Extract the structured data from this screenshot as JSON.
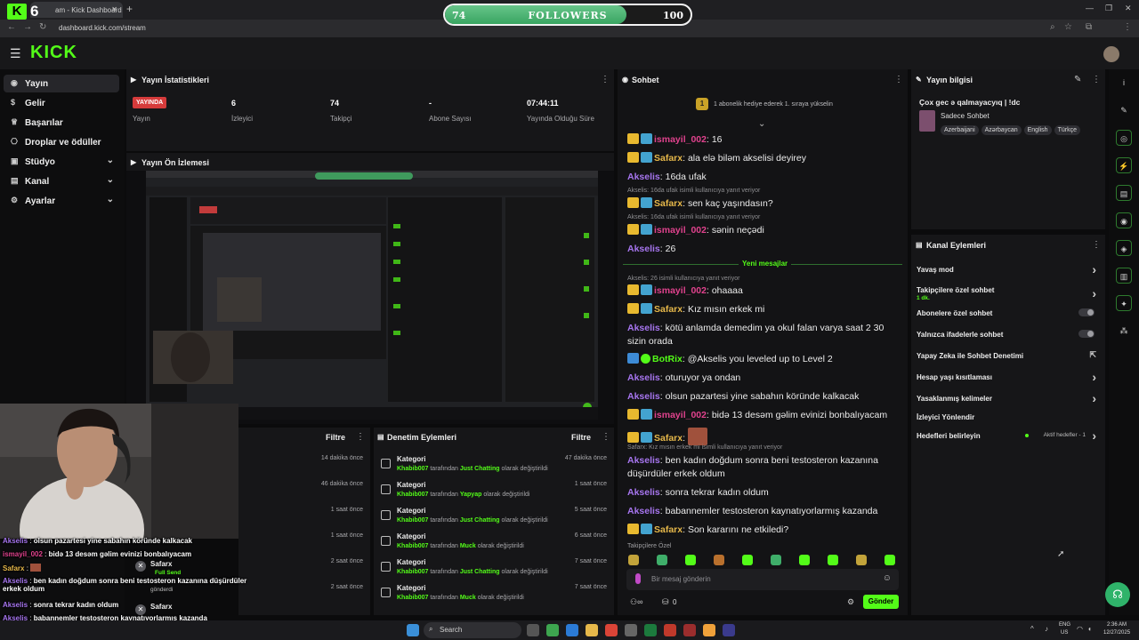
{
  "browser": {
    "tab_title": "am - Kick Dashboard",
    "url": "dashboard.kick.com/stream"
  },
  "overlay": {
    "kick_count": "6",
    "goal": {
      "current": "74",
      "label": "FOLLOWERS",
      "max": "100",
      "progress": 0.74
    }
  },
  "app": {
    "logo": "KICK"
  },
  "sidebar": {
    "items": [
      {
        "label": "Yayın",
        "icon": "broadcast-icon",
        "active": true
      },
      {
        "label": "Gelir",
        "icon": "dollar-icon"
      },
      {
        "label": "Başarılar",
        "icon": "trophy-icon"
      },
      {
        "label": "Droplar ve ödüller",
        "icon": "gift-icon"
      },
      {
        "label": "Stüdyo",
        "icon": "studio-icon",
        "chevron": true
      },
      {
        "label": "Kanal",
        "icon": "channel-icon",
        "chevron": true
      },
      {
        "label": "Ayarlar",
        "icon": "gear-icon",
        "chevron": true
      }
    ]
  },
  "stats": {
    "title": "Yayın İstatistikleri",
    "live_badge": "YAYINDA",
    "items": [
      {
        "value": "",
        "label": "Yayın"
      },
      {
        "value": "6",
        "label": "İzleyici"
      },
      {
        "value": "74",
        "label": "Takipçi"
      },
      {
        "value": "-",
        "label": "Abone Sayısı"
      },
      {
        "value": "07:44:11",
        "label": "Yayında Olduğu Süre"
      }
    ]
  },
  "preview": {
    "title": "Yayın Ön İzlemesi"
  },
  "chat": {
    "title": "Sohbet",
    "pinned": "1 abonelik hediye ederek 1. sıraya yükselin",
    "new_messages": "Yeni mesajlar",
    "input_placeholder": "Bir mesaj gönderin",
    "send_label": "Gönder",
    "followers_only": "Takipçilere Özel",
    "counter": "0",
    "colors": {
      "ismayil": "#e0428d",
      "safarx": "#e6b84a",
      "akselis": "#a675ee",
      "botrix": "#53fc18"
    },
    "messages": [
      {
        "user": "ismayil_002",
        "color": "#e0428d",
        "badges": [
          "crown",
          "sub"
        ],
        "text": "16"
      },
      {
        "user": "Safarx",
        "color": "#e6b84a",
        "badges": [
          "crown",
          "sub"
        ],
        "text": "ala elə biləm akselisi deyirey"
      },
      {
        "user": "Akselis",
        "color": "#a675ee",
        "badges": [],
        "text": "16da ufak"
      },
      {
        "reply": "Akselis: 16da ufak isimli kullanıcıya yanıt veriyor",
        "user": "Safarx",
        "color": "#e6b84a",
        "badges": [
          "crown",
          "sub"
        ],
        "text": "sen kaç yaşındasın?"
      },
      {
        "reply": "Akselis: 16da ufak isimli kullanıcıya yanıt veriyor",
        "user": "ismayil_002",
        "color": "#e0428d",
        "badges": [
          "crown",
          "sub"
        ],
        "text": "sənin neçədi"
      },
      {
        "user": "Akselis",
        "color": "#a675ee",
        "badges": [],
        "text": "26"
      },
      {
        "reply": "Akselis: 26 isimli kullanıcıya yanıt veriyor",
        "user": "ismayil_002",
        "color": "#e0428d",
        "badges": [
          "crown",
          "sub"
        ],
        "text": "ohaaaa"
      },
      {
        "user": "Safarx",
        "color": "#e6b84a",
        "badges": [
          "crown",
          "sub"
        ],
        "text": "Kız mısın erkek mi"
      },
      {
        "user": "Akselis",
        "color": "#a675ee",
        "badges": [],
        "text": "kötü anlamda demedim ya okul falan varya saat 2 30 sizin orada"
      },
      {
        "user": "BotRix",
        "color": "#53fc18",
        "badges": [
          "bot",
          "verif"
        ],
        "text": "@Akselis you leveled up to Level 2"
      },
      {
        "user": "Akselis",
        "color": "#a675ee",
        "badges": [],
        "text": "oturuyor ya ondan"
      },
      {
        "user": "Akselis",
        "color": "#a675ee",
        "badges": [],
        "text": "olsun pazartesi yine sabahın köründe kalkacak"
      },
      {
        "user": "ismayil_002",
        "color": "#e0428d",
        "badges": [
          "crown",
          "sub"
        ],
        "text": "bidə 13 desəm gəlim evinizi bonbalıyacam"
      },
      {
        "user": "Safarx",
        "color": "#e6b84a",
        "badges": [
          "crown",
          "sub"
        ],
        "text": ""
      },
      {
        "reply": "Safarx: Kız mısın erkek mi isimli kullanıcıya yanıt veriyor",
        "user": "Akselis",
        "color": "#a675ee",
        "badges": [],
        "text": "ben kadın doğdum sonra beni testosteron kazanına düşürdüler erkek oldum"
      },
      {
        "user": "Akselis",
        "color": "#a675ee",
        "badges": [],
        "text": "sonra tekrar kadın oldum"
      },
      {
        "user": "Akselis",
        "color": "#a675ee",
        "badges": [],
        "text": "babannemler testosteron kaynatıyorlarmış kazanda"
      },
      {
        "user": "Safarx",
        "color": "#e6b84a",
        "badges": [
          "crown",
          "sub"
        ],
        "text": "Son kararını ne etkiledi?"
      }
    ]
  },
  "info": {
    "title": "Yayın bilgisi",
    "stream_title": "Çox gec ə qalmayacyıq | !dc",
    "category": "Sadece Sohbet",
    "tags": [
      "Azerbaijani",
      "Azərbaycan",
      "English",
      "Türkçe"
    ]
  },
  "actions": {
    "title": "Kanal Eylemleri",
    "rows": [
      {
        "label": "Yavaş mod",
        "kind": "chevron"
      },
      {
        "label": "Takipçilere özel sohbet",
        "sub": "1 dk.",
        "kind": "chevron"
      },
      {
        "label": "Abonelere özel sohbet",
        "kind": "toggle"
      },
      {
        "label": "Yalnızca ifadelerle sohbet",
        "kind": "toggle"
      },
      {
        "label": "Yapay Zeka ile Sohbet Denetimi",
        "kind": "external"
      },
      {
        "label": "Hesap yaşı kısıtlaması",
        "kind": "chevron"
      },
      {
        "label": "Yasaklanmış kelimeler",
        "kind": "chevron"
      },
      {
        "label": "İzleyici Yönlendir",
        "kind": "none"
      },
      {
        "label": "Hedefleri belirleyin",
        "kind": "chevron",
        "status": "Aktif hedefler - 1"
      }
    ]
  },
  "activity": {
    "filter": "Filtre",
    "times": [
      "14 dakika önce",
      "46 dakika önce",
      "1 saat önce",
      "1 saat önce",
      "2 saat önce",
      "2 saat önce"
    ],
    "overlay_names": [
      "Safarx",
      "Safarx"
    ],
    "overlay_notes": [
      "Full Send",
      "gönderdi"
    ]
  },
  "modlog": {
    "title": "Denetim Eylemleri",
    "filter": "Filtre",
    "rows": [
      {
        "title": "Kategori",
        "user": "Khabib007",
        "mid": "tarafından",
        "cat": "Just Chatting",
        "end": "olarak değiştirildi",
        "time": "47 dakika önce"
      },
      {
        "title": "Kategori",
        "user": "Khabib007",
        "mid": "tarafından",
        "cat": "Yapyap",
        "end": "olarak değiştirildi",
        "time": "1 saat önce"
      },
      {
        "title": "Kategori",
        "user": "Khabib007",
        "mid": "tarafından",
        "cat": "Just Chatting",
        "end": "olarak değiştirildi",
        "time": "5 saat önce"
      },
      {
        "title": "Kategori",
        "user": "Khabib007",
        "mid": "tarafından",
        "cat": "Muck",
        "end": "olarak değiştirildi",
        "time": "6 saat önce"
      },
      {
        "title": "Kategori",
        "user": "Khabib007",
        "mid": "tarafından",
        "cat": "Just Chatting",
        "end": "olarak değiştirildi",
        "time": "7 saat önce"
      },
      {
        "title": "Kategori",
        "user": "Khabib007",
        "mid": "tarafından",
        "cat": "Muck",
        "end": "olarak değiştirildi",
        "time": "7 saat önce"
      }
    ]
  },
  "overlay_chat": [
    {
      "user": "Akselis",
      "color": "#a675ee",
      "text": "olsun pazartesi yine sabahın köründe kalkacak"
    },
    {
      "user": "ismayil_002",
      "color": "#e0428d",
      "text": "bidə 13 desəm gəlim evinizi bonbalıyacam"
    },
    {
      "user": "Safarx",
      "color": "#e6b84a",
      "text": ""
    },
    {
      "user": "Akselis",
      "color": "#a675ee",
      "text": "ben kadın doğdum sonra beni testosteron kazanına düşürdüler erkek oldum"
    },
    {
      "user": "Akselis",
      "color": "#a675ee",
      "text": "sonra tekrar kadın oldum"
    },
    {
      "user": "Akselis",
      "color": "#a675ee",
      "text": "babannemler testosteron kaynatıyorlarmış kazanda"
    },
    {
      "user": "Safarx",
      "color": "#e6b84a",
      "text": "Son kararını ne etkiledi?"
    }
  ],
  "taskbar": {
    "search_label": "Search",
    "lang": "ENG",
    "region": "US",
    "time": "2:36 AM",
    "date": "12/27/2025"
  }
}
